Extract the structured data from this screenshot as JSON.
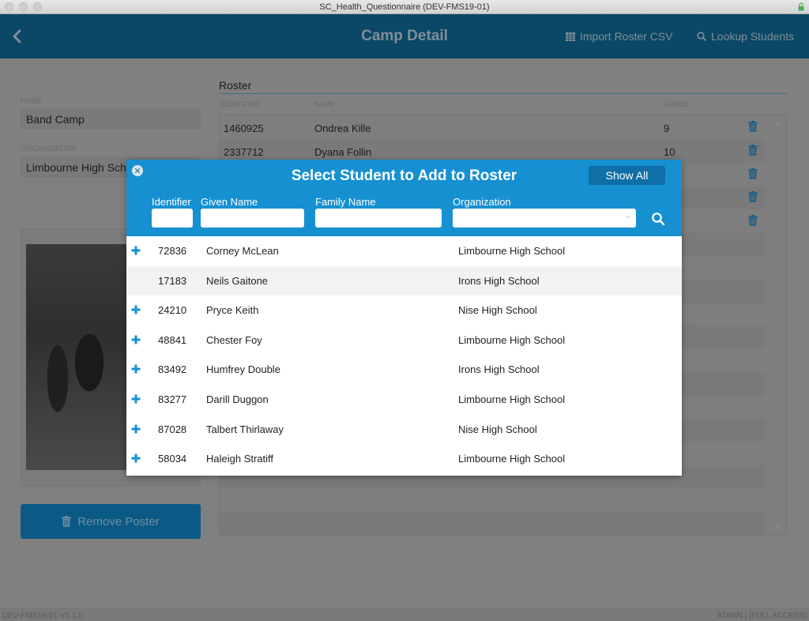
{
  "window": {
    "title": "SC_Health_Questionnaire (DEV-FMS19-01)"
  },
  "header": {
    "title": "Camp Detail",
    "import_label": "Import Roster CSV",
    "lookup_label": "Lookup Students"
  },
  "camp": {
    "name_label": "NAME",
    "name_value": "Band Camp",
    "org_label": "ORGANIZATION",
    "org_value": "Limbourne High School",
    "remove_poster_label": "Remove Poster"
  },
  "roster": {
    "title": "Roster",
    "columns": [
      "IDENTIFIER",
      "NAME",
      "GRADE"
    ],
    "rows": [
      {
        "id": "1460925",
        "name": "Ondrea Kille",
        "grade": "9"
      },
      {
        "id": "2337712",
        "name": "Dyana Follin",
        "grade": "10"
      },
      {
        "id": "",
        "name": "",
        "grade": ""
      },
      {
        "id": "",
        "name": "",
        "grade": ""
      },
      {
        "id": "",
        "name": "",
        "grade": ""
      }
    ]
  },
  "modal": {
    "title": "Select Student to Add to Roster",
    "show_all_label": "Show All",
    "filters": {
      "identifier_label": "Identifier",
      "given_label": "Given Name",
      "family_label": "Family Name",
      "org_label": "Organization",
      "identifier_value": "",
      "given_value": "",
      "family_value": "",
      "org_value": ""
    },
    "students": [
      {
        "id": "72836",
        "name": "Corney McLean",
        "org": "Limbourne High School",
        "addable": true
      },
      {
        "id": "17183",
        "name": "Neils Gaitone",
        "org": "Irons High School",
        "addable": false
      },
      {
        "id": "24210",
        "name": "Pryce Keith",
        "org": "Nise High School",
        "addable": true
      },
      {
        "id": "48841",
        "name": "Chester Foy",
        "org": "Limbourne High School",
        "addable": true
      },
      {
        "id": "83492",
        "name": "Humfrey Double",
        "org": "Irons High School",
        "addable": true
      },
      {
        "id": "83277",
        "name": "Darill Duggon",
        "org": "Limbourne High School",
        "addable": true
      },
      {
        "id": "87028",
        "name": "Talbert Thirlaway",
        "org": "Nise High School",
        "addable": true
      },
      {
        "id": "58034",
        "name": "Haleigh Stratiff",
        "org": "Limbourne High School",
        "addable": true
      }
    ]
  },
  "status": {
    "left": "DEV-FMS19-01 V1.1.0",
    "right": "ADMIN | [FULL ACCESS]"
  },
  "colors": {
    "header_bg": "#0b4766",
    "modal_accent": "#1690d1",
    "overlay": "#808080"
  }
}
